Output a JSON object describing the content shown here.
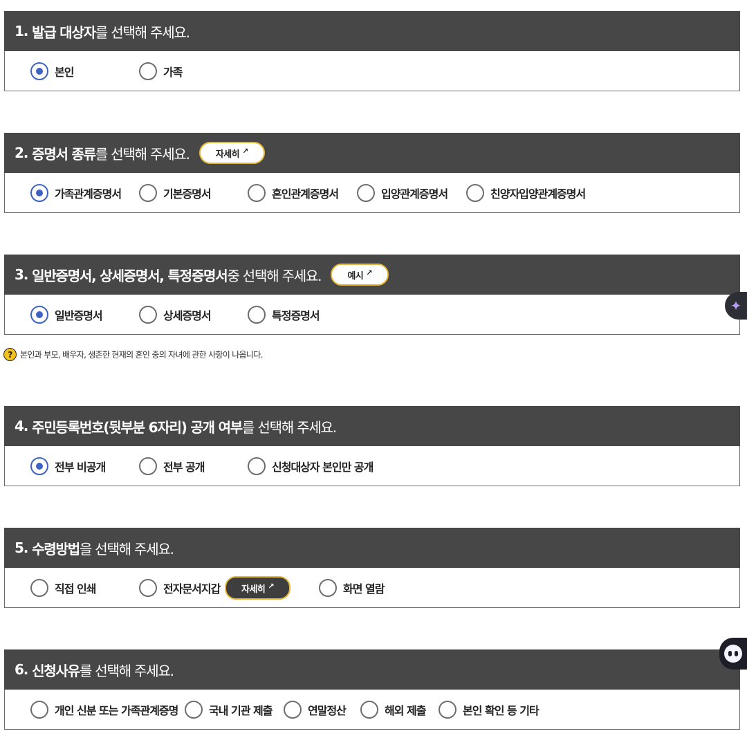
{
  "sections": [
    {
      "number": "1.",
      "title_bold": "발급 대상자",
      "title_rest": "를 선택해 주세요.",
      "options": [
        {
          "label": "본인",
          "checked": true
        },
        {
          "label": "가족",
          "checked": false
        }
      ]
    },
    {
      "number": "2.",
      "title_bold": "증명서 종류",
      "title_rest": "를 선택해 주세요.",
      "button_label": "자세히",
      "options": [
        {
          "label": "가족관계증명서",
          "checked": true
        },
        {
          "label": "기본증명서",
          "checked": false
        },
        {
          "label": "혼인관계증명서",
          "checked": false
        },
        {
          "label": "입양관계증명서",
          "checked": false
        },
        {
          "label": "친양자입양관계증명서",
          "checked": false
        }
      ]
    },
    {
      "number": "3.",
      "title_bold": "일반증명서, 상세증명서, 특정증명서",
      "title_rest": " 중 선택해 주세요.",
      "button_label": "예시",
      "options": [
        {
          "label": "일반증명서",
          "checked": true
        },
        {
          "label": "상세증명서",
          "checked": false
        },
        {
          "label": "특정증명서",
          "checked": false
        }
      ]
    },
    {
      "number": "4.",
      "title_bold": "주민등록번호(뒷부분 6자리) 공개 여부",
      "title_rest": "를 선택해 주세요.",
      "options": [
        {
          "label": "전부 비공개",
          "checked": true
        },
        {
          "label": "전부 공개",
          "checked": false
        },
        {
          "label": "신청대상자 본인만 공개",
          "checked": false
        }
      ]
    },
    {
      "number": "5.",
      "title_bold": "수령방법",
      "title_rest": "을 선택해 주세요.",
      "inline_button_label": "자세히",
      "options": [
        {
          "label": "직접 인쇄",
          "checked": false
        },
        {
          "label": "전자문서지갑",
          "checked": false
        },
        {
          "label": "화면 열람",
          "checked": false
        }
      ]
    },
    {
      "number": "6.",
      "title_bold": "신청사유",
      "title_rest": "를 선택해 주세요.",
      "options": [
        {
          "label": "개인 신분 또는 가족관계증명",
          "checked": false
        },
        {
          "label": "국내 기관 제출",
          "checked": false
        },
        {
          "label": "연말정산",
          "checked": false
        },
        {
          "label": "해외 제출",
          "checked": false
        },
        {
          "label": "본인 확인 등 기타",
          "checked": false
        }
      ]
    }
  ],
  "notice": {
    "icon": "question-icon",
    "text": "본인과 부모, 배우자, 생존한 현재의 혼인 중의 자녀에 관한 사항이 나옵니다."
  },
  "icons": {
    "external_link": "↗",
    "ai_sparkle": "✦"
  },
  "colors": {
    "header_bg": "#474747",
    "radio_checked": "#3c63c2",
    "button_border": "#e7b93a",
    "question_icon": "#f2c21a"
  }
}
